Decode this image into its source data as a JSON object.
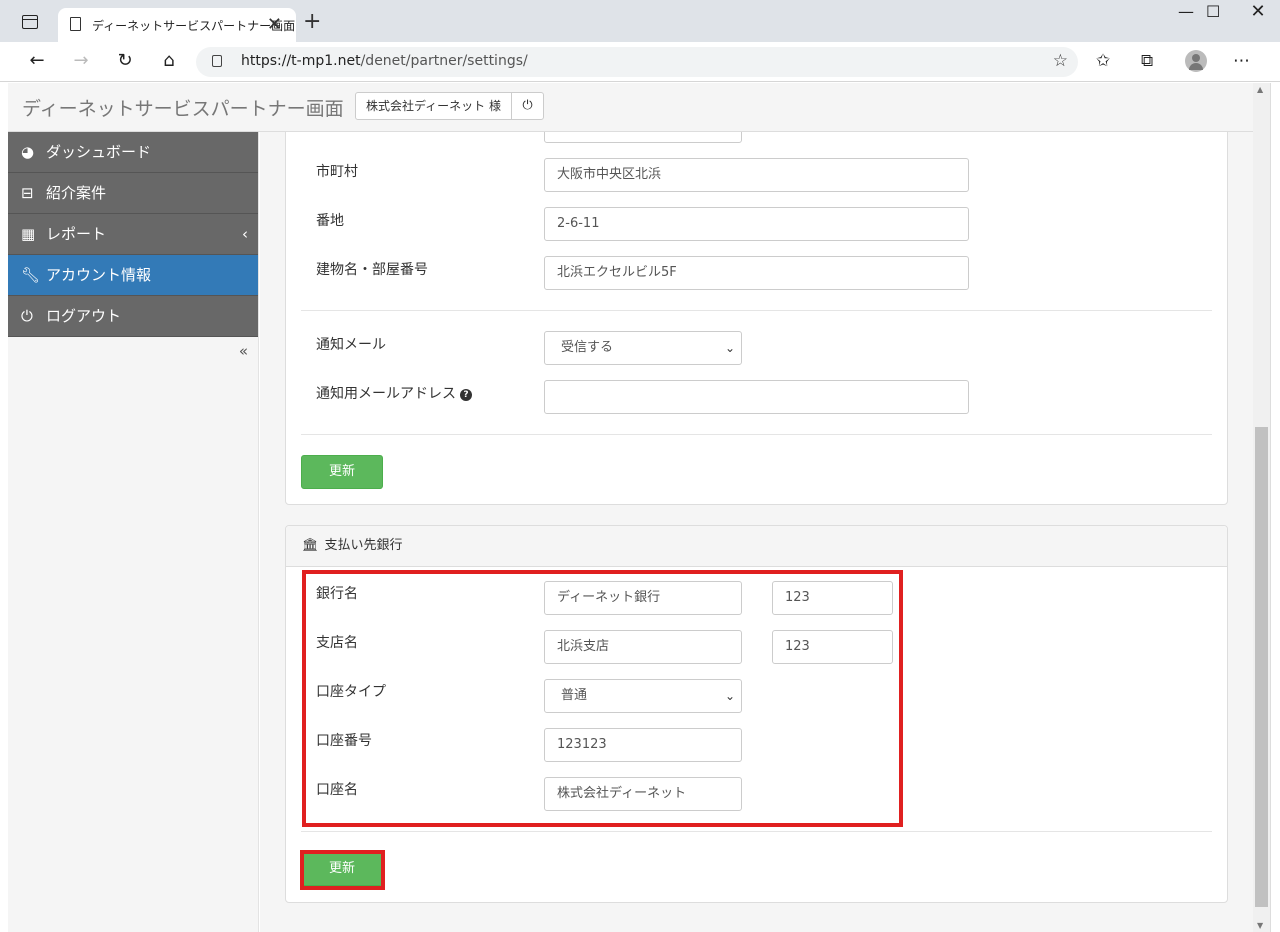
{
  "browser": {
    "tab_title": "ディーネットサービスパートナー画面",
    "tab_close": "✕",
    "new_tab": "+",
    "url_host": "https://t-mp1.net",
    "url_path": "/denet/partner/settings/",
    "minimize": "—",
    "maximize": "☐",
    "close": "✕"
  },
  "header": {
    "title": "ディーネットサービスパートナー画面",
    "user_label": "株式会社ディーネット 様"
  },
  "sidebar": {
    "items": [
      {
        "label": "ダッシュボード",
        "icon": "dashboard-icon"
      },
      {
        "label": "紹介案件",
        "icon": "basket-icon"
      },
      {
        "label": "レポート",
        "icon": "table-icon"
      },
      {
        "label": "アカウント情報",
        "icon": "wrench-icon"
      },
      {
        "label": "ログアウト",
        "icon": "power-icon"
      }
    ],
    "report_caret": "‹",
    "collapse": "«"
  },
  "account_form": {
    "city_label": "市町村",
    "city_value": "大阪市中央区北浜",
    "street_label": "番地",
    "street_value": "2-6-11",
    "building_label": "建物名・部屋番号",
    "building_value": "北浜エクセルビル5F",
    "notify_mail_label": "通知メール",
    "notify_mail_value": "受信する",
    "notify_address_label": "通知用メールアドレス",
    "notify_address_value": "",
    "update_button": "更新"
  },
  "bank_form": {
    "heading": "支払い先銀行",
    "bank_name_label": "銀行名",
    "bank_name_value": "ディーネット銀行",
    "bank_code_value": "123",
    "branch_label": "支店名",
    "branch_value": "北浜支店",
    "branch_code_value": "123",
    "account_type_label": "口座タイプ",
    "account_type_value": "普通",
    "account_number_label": "口座番号",
    "account_number_value": "123123",
    "account_name_label": "口座名",
    "account_name_value": "株式会社ディーネット",
    "update_button": "更新"
  },
  "colors": {
    "sidebar_bg": "#686868",
    "sidebar_active": "#337ab7",
    "update_button": "#5cb85c",
    "highlight": "#e02020"
  }
}
